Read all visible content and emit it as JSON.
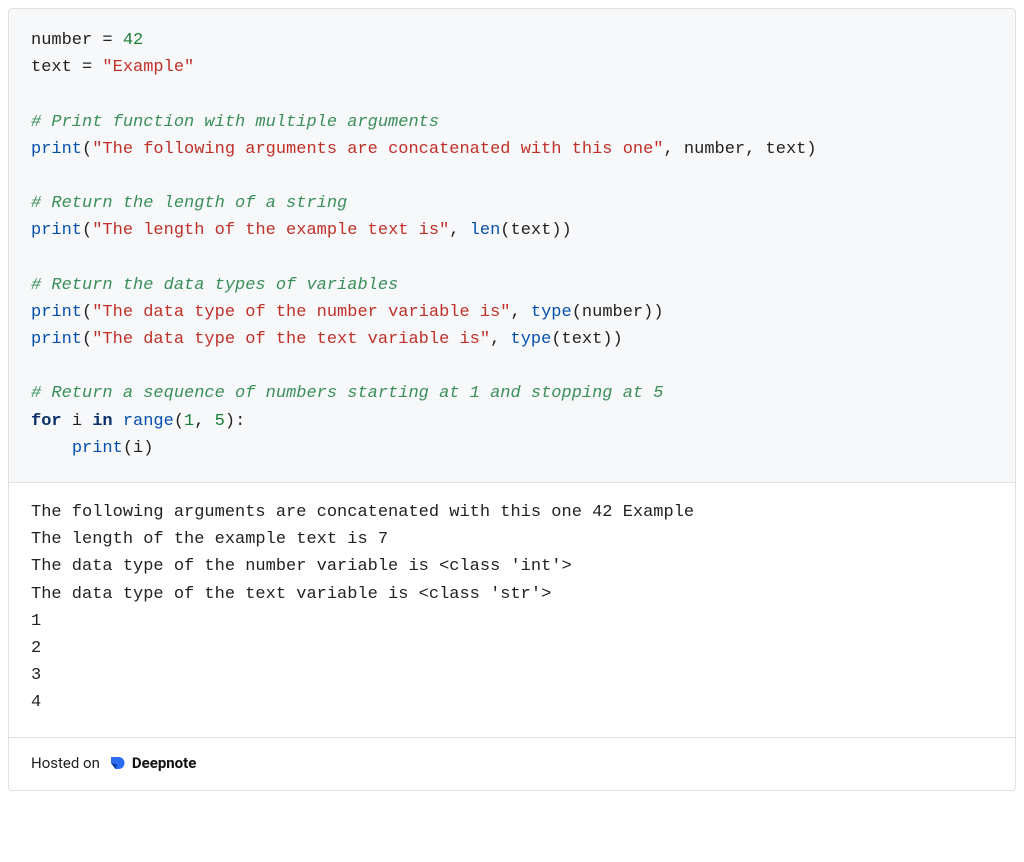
{
  "code": {
    "l1": {
      "var": "number",
      "eq": " = ",
      "num": "42"
    },
    "l2": {
      "var": "text",
      "eq": " = ",
      "str": "\"Example\""
    },
    "l4": {
      "cmt": "# Print function with multiple arguments"
    },
    "l5": {
      "fn": "print",
      "lp": "(",
      "str": "\"The following arguments are concatenated with this one\"",
      "c1": ", ",
      "a1": "number",
      "c2": ", ",
      "a2": "text",
      "rp": ")"
    },
    "l7": {
      "cmt": "# Return the length of a string"
    },
    "l8": {
      "fn": "print",
      "lp": "(",
      "str": "\"The length of the example text is\"",
      "c1": ", ",
      "fn2": "len",
      "lp2": "(",
      "a1": "text",
      "rp2": ")",
      "rp": ")"
    },
    "l10": {
      "cmt": "# Return the data types of variables"
    },
    "l11": {
      "fn": "print",
      "lp": "(",
      "str": "\"The data type of the number variable is\"",
      "c1": ", ",
      "fn2": "type",
      "lp2": "(",
      "a1": "number",
      "rp2": ")",
      "rp": ")"
    },
    "l12": {
      "fn": "print",
      "lp": "(",
      "str": "\"The data type of the text variable is\"",
      "c1": ", ",
      "fn2": "type",
      "lp2": "(",
      "a1": "text",
      "rp2": ")",
      "rp": ")"
    },
    "l14": {
      "cmt": "# Return a sequence of numbers starting at 1 and stopping at 5"
    },
    "l15": {
      "kw1": "for",
      "sp1": " ",
      "var": "i",
      "sp2": " ",
      "kw2": "in",
      "sp3": " ",
      "fn": "range",
      "lp": "(",
      "n1": "1",
      "c1": ", ",
      "n2": "5",
      "rp": ")",
      "col": ":"
    },
    "l16": {
      "indent": "    ",
      "fn": "print",
      "lp": "(",
      "a1": "i",
      "rp": ")"
    }
  },
  "output": {
    "l1": "The following arguments are concatenated with this one 42 Example",
    "l2": "The length of the example text is 7",
    "l3": "The data type of the number variable is <class 'int'>",
    "l4": "The data type of the text variable is <class 'str'>",
    "l5": "1",
    "l6": "2",
    "l7": "3",
    "l8": "4"
  },
  "footer": {
    "hosted": "Hosted on",
    "brand": "Deepnote"
  }
}
